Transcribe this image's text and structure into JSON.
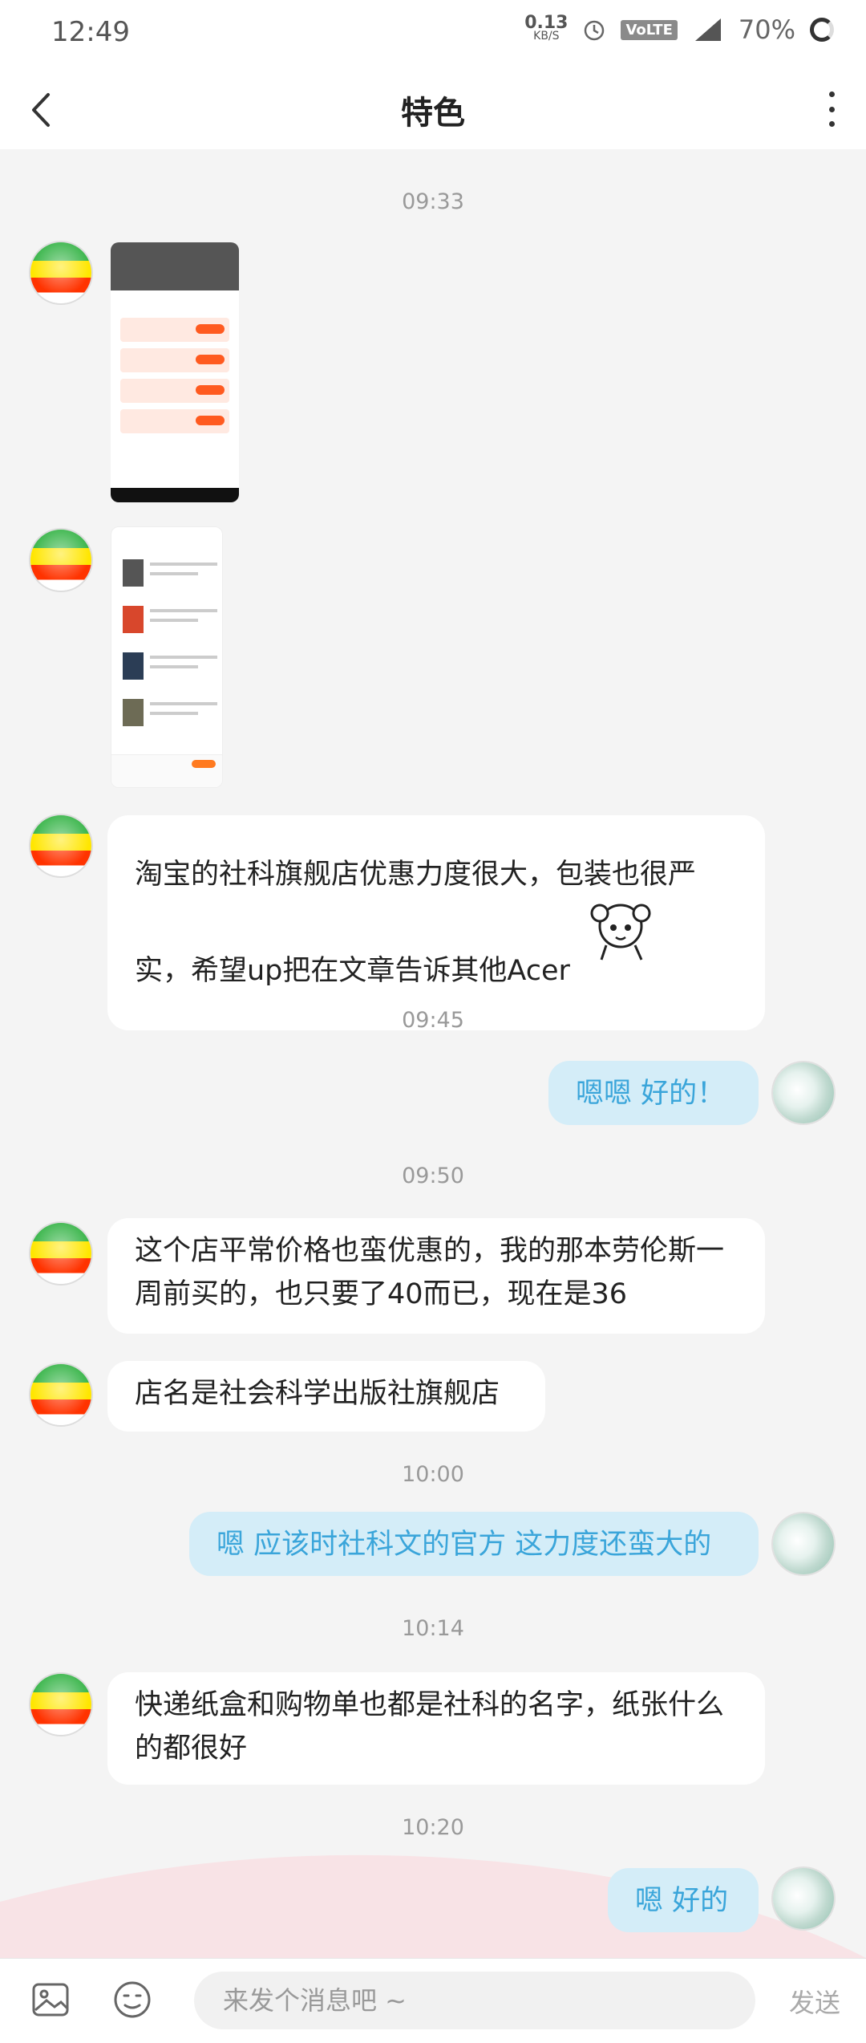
{
  "status_bar": {
    "time": "12:49",
    "net_speed": "0.13",
    "net_unit": "KB/S",
    "volte": "VoLTE",
    "signal": "4G",
    "battery": "70%"
  },
  "header": {
    "title": "特色"
  },
  "messages": {
    "ts1": "09:33",
    "m3": "淘宝的社科旗舰店优惠力度很大，包装也很严实，希望up把在文章告诉其他Acer",
    "ts2": "09:45",
    "m4": "嗯嗯 好的！",
    "ts3": "09:50",
    "m5": "这个店平常价格也蛮优惠的，我的那本劳伦斯一周前买的，也只要了40而已，现在是36",
    "m6": "店名是社会科学出版社旗舰店",
    "ts4": "10:00",
    "m7": "嗯 应该时社科文的官方 这力度还蛮大的",
    "ts5": "10:14",
    "m8": "快递纸盒和购物单也都是社科的名字，纸张什么的都很好",
    "ts6": "10:20",
    "m9": "嗯 好的"
  },
  "composer": {
    "placeholder": "来发个消息吧 ~",
    "send_label": "发送"
  },
  "icons": {
    "back": "back-arrow-icon",
    "more": "more-vertical-icon",
    "image": "image-icon",
    "emoji": "emoji-icon"
  }
}
